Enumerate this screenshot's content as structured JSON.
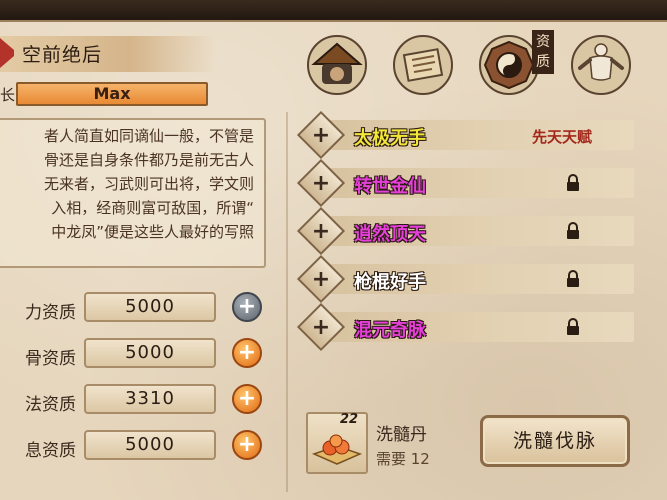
{
  "character": {
    "title": "空前绝后",
    "bar_label": "长",
    "bar_value": "Max",
    "description": "者人简直如同谪仙一般，不管是\n骨还是自身条件都乃是前无古人\n无来者，习武则可出将，学文则\n入相，经商则富可敌国，所谓“\n中龙凤”便是这些人最好的写照"
  },
  "attributes": [
    {
      "label": "力资质",
      "value": "5000",
      "button": "gray"
    },
    {
      "label": "骨资质",
      "value": "5000",
      "button": "orange"
    },
    {
      "label": "法资质",
      "value": "3310",
      "button": "orange"
    },
    {
      "label": "息资质",
      "value": "5000",
      "button": "orange"
    }
  ],
  "tabs": [
    {
      "name": "swordsman-hat-icon"
    },
    {
      "name": "scroll-icon"
    },
    {
      "name": "bagua-icon",
      "badge": "资质",
      "active": true
    },
    {
      "name": "martial-artist-icon"
    }
  ],
  "talents": [
    {
      "name": "太极无手",
      "color": "#f2e63a",
      "tag": "先天天赋",
      "locked": false
    },
    {
      "name": "转世金仙",
      "color": "#e53fd9",
      "tag": "",
      "locked": true
    },
    {
      "name": "逍然顶天",
      "color": "#e53fd9",
      "tag": "",
      "locked": true
    },
    {
      "name": "枪棍好手",
      "color": "#ffffff",
      "tag": "",
      "locked": true
    },
    {
      "name": "混元奇脉",
      "color": "#e53fd9",
      "tag": "",
      "locked": true
    }
  ],
  "item": {
    "count": "22",
    "name": "洗髓丹",
    "need": "需要 12",
    "action": "洗髓伐脉"
  }
}
